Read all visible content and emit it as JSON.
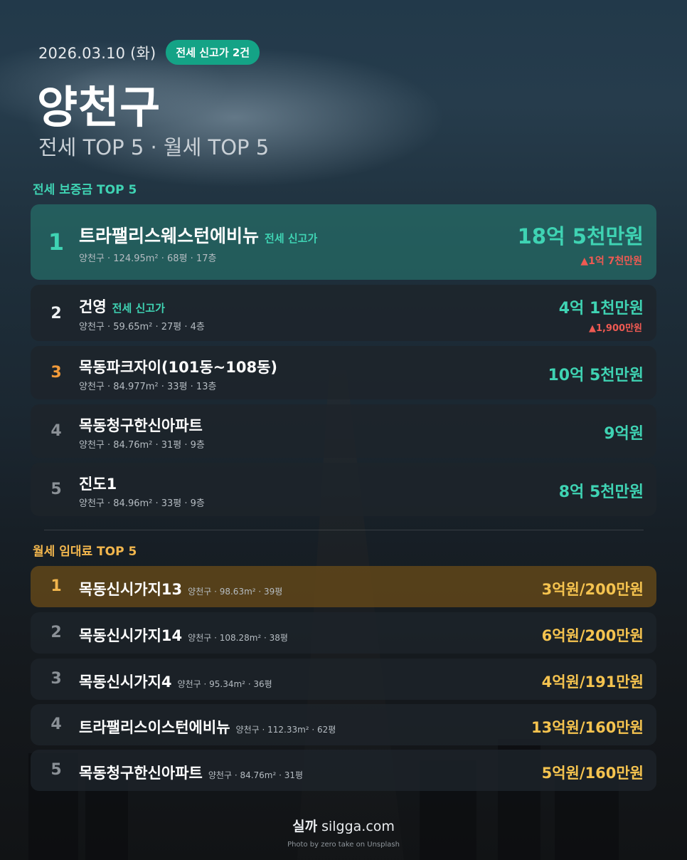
{
  "header": {
    "date": "2026.03.10 (화)",
    "badge": "전세 신고가 2건",
    "title": "양천구",
    "subtitle": "전세 TOP 5 · 월세 TOP 5"
  },
  "jeonse": {
    "section_title": "전세 보증금 TOP 5",
    "items": [
      {
        "rank": "1",
        "name": "트라팰리스웨스턴에비뉴",
        "tag": "전세 신고가",
        "meta": "양천구 · 124.95m² · 68평 · 17층",
        "price": "18억 5천만원",
        "delta": "▲1억 7천만원"
      },
      {
        "rank": "2",
        "name": "건영",
        "tag": "전세 신고가",
        "meta": "양천구 · 59.65m² · 27평 · 4층",
        "price": "4억 1천만원",
        "delta": "▲1,900만원"
      },
      {
        "rank": "3",
        "name": "목동파크자이(101동~108동)",
        "meta": "양천구 · 84.977m² · 33평 · 13층",
        "price": "10억 5천만원"
      },
      {
        "rank": "4",
        "name": "목동청구한신아파트",
        "meta": "양천구 · 84.76m² · 31평 · 9층",
        "price": "9억원"
      },
      {
        "rank": "5",
        "name": "진도1",
        "meta": "양천구 · 84.96m² · 33평 · 9층",
        "price": "8억 5천만원"
      }
    ]
  },
  "wolse": {
    "section_title": "월세 임대료 TOP 5",
    "items": [
      {
        "rank": "1",
        "name": "목동신시가지13",
        "meta": "양천구 · 98.63m² · 39평",
        "price": "3억원/200만원"
      },
      {
        "rank": "2",
        "name": "목동신시가지14",
        "meta": "양천구 · 108.28m² · 38평",
        "price": "6억원/200만원"
      },
      {
        "rank": "3",
        "name": "목동신시가지4",
        "meta": "양천구 · 95.34m² · 36평",
        "price": "4억원/191만원"
      },
      {
        "rank": "4",
        "name": "트라팰리스이스턴에비뉴",
        "meta": "양천구 · 112.33m² · 62평",
        "price": "13억원/160만원"
      },
      {
        "rank": "5",
        "name": "목동청구한신아파트",
        "meta": "양천구 · 84.76m² · 31평",
        "price": "5억원/160만원"
      }
    ]
  },
  "footer": {
    "brand_kr": "실까",
    "brand_url": "silgga.com",
    "credit": "Photo by zero take on Unsplash"
  },
  "colors": {
    "teal": "#3fd3b3",
    "badge": "#14a386",
    "gold": "#f5c34f",
    "up": "#ef5a52"
  }
}
